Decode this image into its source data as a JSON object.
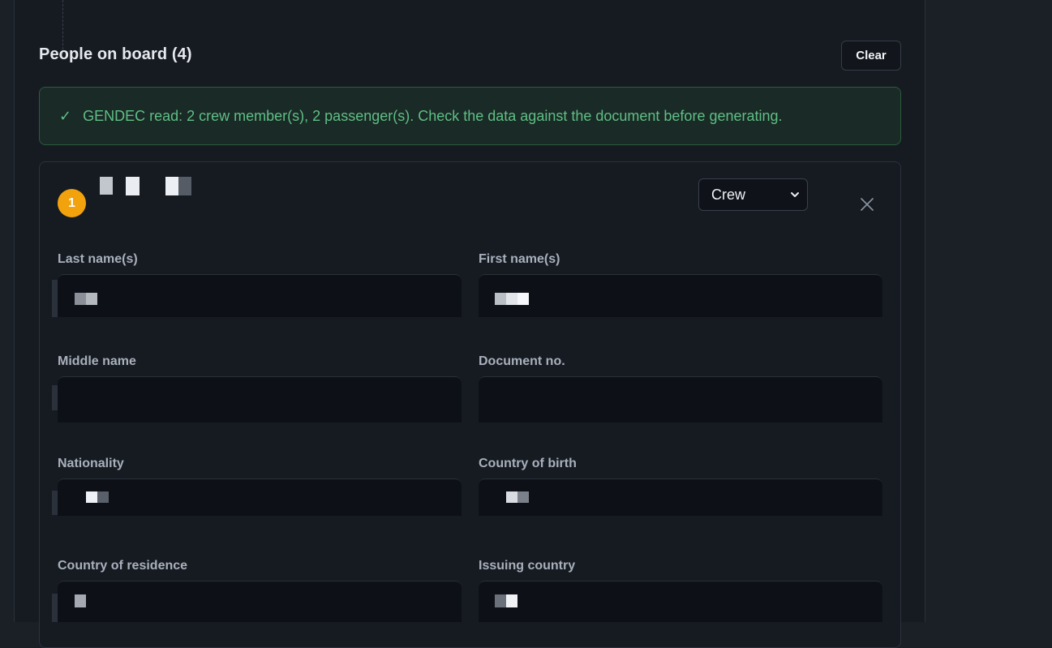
{
  "section": {
    "title": "People on board (4)",
    "clear_label": "Clear"
  },
  "notice": {
    "icon": "check-icon",
    "text": "GENDEC read: 2 crew member(s), 2 passenger(s). Check the data against the document before generating."
  },
  "person": {
    "index": "1",
    "role": "Crew",
    "fields": {
      "last_name": {
        "label": "Last name(s)"
      },
      "first_name": {
        "label": "First name(s)"
      },
      "middle_name": {
        "label": "Middle name"
      },
      "document_no": {
        "label": "Document no."
      },
      "nationality": {
        "label": "Nationality"
      },
      "country_of_birth": {
        "label": "Country of birth"
      },
      "country_of_residence": {
        "label": "Country of residence"
      },
      "issuing_country": {
        "label": "Issuing country"
      }
    }
  },
  "colors": {
    "accent_badge": "#f2a20c",
    "success_text": "#5fbf85",
    "success_border": "#2c5a3f"
  }
}
